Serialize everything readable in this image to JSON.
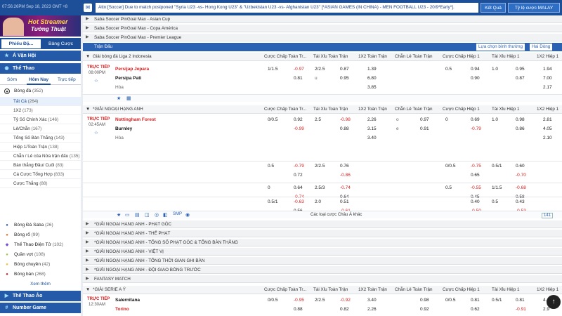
{
  "topbar": {
    "time": "07:56:26PM Sep 18, 2023 GMT +8",
    "ticker": "Attn:[Soccer] Due to match postponed \"Syria U23 -vs- Hong Kong U23\" & \"Uzbekistan U23 -vs- Afghanistan U23\" [*ASIAN GAMES (IN CHINA) - MEN FOOTBALL U23 - 20/9*Early*].",
    "result_btn": "Kết Quả",
    "odds_btn": "Tỷ lệ cược MALAY"
  },
  "banner": {
    "line1": "Hot Streamer",
    "line2": "Tường Thuật"
  },
  "sidebar": {
    "tab1": "Phiếu Đặ...",
    "tab2": "Bảng Cược",
    "section1": "Á Vận Hội",
    "section2": "Thể Thao",
    "subtabs": [
      "Sớm",
      "Hôm Nay",
      "Trực tiếp"
    ],
    "sports_top": {
      "label": "Bóng đá",
      "count": "(352)"
    },
    "sub_items": [
      {
        "label": "Tất Cả",
        "count": "(264)"
      },
      {
        "label": "1X2",
        "count": "(173)"
      },
      {
        "label": "Tỷ Số Chính Xác",
        "count": "(146)"
      },
      {
        "label": "Lẻ/Chẵn",
        "count": "(167)"
      },
      {
        "label": "Tổng Số Bàn Thắng",
        "count": "(143)"
      },
      {
        "label": "Hiệp 1/Toàn Trận",
        "count": "(138)"
      },
      {
        "label": "Chẵn / Lẻ của Nửa trận đấu",
        "count": "(135)"
      },
      {
        "label": "Bàn thắng Đầu/ Cuối",
        "count": "(83)"
      },
      {
        "label": "Cá Cược Tổng Hợp",
        "count": "(833)"
      },
      {
        "label": "Cược Thắng",
        "count": "(88)"
      }
    ],
    "sports": [
      {
        "label": "Bóng Đá Saba",
        "count": "(26)"
      },
      {
        "label": "Bóng rổ",
        "count": "(99)"
      },
      {
        "label": "Thể Thao Điện Tử",
        "count": "(102)"
      },
      {
        "label": "Quần vợt",
        "count": "(108)"
      },
      {
        "label": "Bóng chuyền",
        "count": "(42)"
      },
      {
        "label": "Bóng bàn",
        "count": "(268)"
      }
    ],
    "more": "Xem thêm",
    "section3": "Thể Thao Ảo",
    "section4": "Number Game"
  },
  "top_leagues": [
    "Saba Soccer PinGoal Max - Asian Cup",
    "Saba Soccer PinGoal Max - Copa América",
    "Saba Soccer PinGoal Max - Premier League"
  ],
  "header": {
    "title": "Trận Đấu",
    "sort": "Lựa chọn bình thường",
    "lines": "Hai Dòng"
  },
  "columns": {
    "ft_hdp": "Cược Chấp Toàn Tr...",
    "ft_ou": "Tài Xỉu Toàn Trận",
    "ft_1x2": "1X2 Toàn Trận",
    "ft_oe": "Chẵn Lẻ Toàn Trận",
    "h1_hdp": "Cược Chấp Hiệp 1",
    "h1_ou": "Tài Xỉu Hiệp 1",
    "h1_1x2": "1X2 Hiệp 1"
  },
  "leagues": {
    "indo": "Giải bóng đá Liga 2 Indonesia",
    "epl": "*GIẢI NGOẠI HẠNG ANH",
    "seriea": "*GIẢI SERIE A Ý"
  },
  "match1": {
    "live": "TRỰC TIẾP",
    "time": "08:00PM",
    "home": "Persijap Jepara",
    "away": "Persipa Pati",
    "draw": "Hòa",
    "hdp_line": "1/1.5",
    "hdp_h": "-0.97",
    "hdp_a": "0.81",
    "ou_line": "2/2.5",
    "ou_u": "u",
    "ou_o": "0.87",
    "ou_u_val": "0.95",
    "x1": "1.39",
    "x2": "6.80",
    "xd": "3.85",
    "h1_hdp_line": "0.5",
    "h1_hdp_h": "0.94",
    "h1_hdp_a": "0.90",
    "h1_ou_line": "1.0",
    "h1_ou_o": "0.95",
    "h1_ou_u": "0.87",
    "h1x1": "1.94",
    "h1x2": "7.00",
    "h1xd": "2.17"
  },
  "match2": {
    "live": "TRỰC TIẾP",
    "time": "02:45AM",
    "home": "Nottingham Forest",
    "away": "Burnley",
    "draw": "Hòa",
    "rows": [
      [
        "0/0.5",
        "0.92",
        "-0.99",
        "2.5",
        "-0.98",
        "0.88",
        "2.26",
        "3.15",
        "3.40",
        "0.97",
        "0.91",
        "0",
        "0.69",
        "-0.79",
        "1.0",
        "0.98",
        "0.86",
        "2.81",
        "4.05",
        "2.10"
      ],
      [
        "0.5",
        "-0.79",
        "0.72",
        "2/2.5",
        "0.76",
        "-0.86",
        "",
        "",
        "",
        "",
        "",
        "0/0.5",
        "-0.75",
        "0.65",
        "0.5/1",
        "0.60",
        "-0.70",
        "",
        "",
        ""
      ],
      [
        "0",
        "0.64",
        "-0.74",
        "2.5/3",
        "-0.74",
        "0.64",
        "",
        "",
        "",
        "",
        "",
        "0.5",
        "-0.55",
        "0.45",
        "1/1.5",
        "-0.68",
        "0.58",
        "",
        "",
        ""
      ],
      [
        "0.5/1",
        "-0.63",
        "0.56",
        "2.0",
        "0.51",
        "-0.61",
        "",
        "",
        "",
        "",
        "",
        "",
        "0.40",
        "-0.50",
        "0.5",
        "0.43",
        "-0.53",
        "",
        "",
        ""
      ]
    ],
    "more_bets": "Các loại cược Châu Á khác",
    "count": "141"
  },
  "sub_leagues": [
    "*GIẢI NGOẠI HẠNG ANH - PHẠT GÓC",
    "*GIẢI NGOẠI HẠNG ANH - THẺ PHẠT",
    "*GIẢI NGOẠI HẠNG ANH - TỔNG SỐ PHẠT GÓC & TỔNG BÀN THẮNG",
    "*GIẢI NGOẠI HẠNG ANH - VIỆT VỊ",
    "*GIẢI NGOẠI HẠNG ANH - TỔNG THỜI GIAN GHI BÀN",
    "*GIẢI NGOẠI HẠNG ANH - ĐỘI GIAO BÓNG TRƯỚC",
    "FANTASY MATCH"
  ],
  "match3": {
    "live": "TRỰC TIẾP",
    "time": "12:30AM",
    "home": "Salernitana",
    "away": "Torino",
    "hdp_line": "0/0.5",
    "hdp_h": "-0.95",
    "hdp_a": "0.88",
    "ou_line": "2/2.5",
    "ou_h": "-0.92",
    "ou_a": "0.82",
    "x1": "3.40",
    "x2": "2.26",
    "oe_o": "0.98",
    "oe_e": "0.92",
    "h1_hdp_line": "0/0.5",
    "h1_hdp_h": "0.81",
    "h1_hdp_a": "0.62",
    "h1_ou_line": "0.5/1",
    "h1_ou_o": "0.81",
    "h1_ou_u": "-0.91",
    "h1x1": "4.4",
    "h1x2": "2.9"
  }
}
